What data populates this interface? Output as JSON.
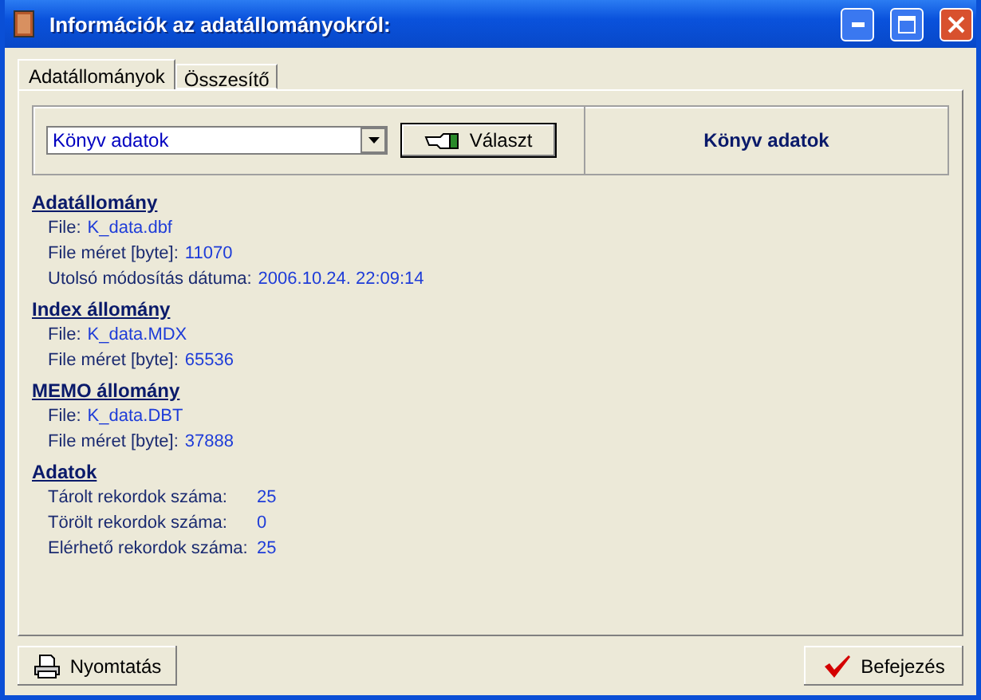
{
  "window": {
    "title": "Információk az adatállományokról:"
  },
  "tabs": [
    {
      "label": "Adatállományok",
      "selected": true
    },
    {
      "label": "Összesítő",
      "selected": false
    }
  ],
  "selector": {
    "value": "Könyv adatok",
    "button": "Választ",
    "caption": "Könyv adatok"
  },
  "sections": [
    {
      "title": "Adatállomány",
      "kind": "inline",
      "rows": [
        {
          "label": "File:",
          "value": "K_data.dbf"
        },
        {
          "label": "File méret [byte]:",
          "value": "11070"
        },
        {
          "label": "Utolsó módosítás dátuma:",
          "value": "2006.10.24. 22:09:14"
        }
      ]
    },
    {
      "title": "Index állomány",
      "kind": "inline",
      "rows": [
        {
          "label": "File:",
          "value": "K_data.MDX"
        },
        {
          "label": "File méret [byte]:",
          "value": "65536"
        }
      ]
    },
    {
      "title": "MEMO állomány",
      "kind": "inline",
      "rows": [
        {
          "label": "File:",
          "value": "K_data.DBT"
        },
        {
          "label": "File méret [byte]:",
          "value": "37888"
        }
      ]
    },
    {
      "title": "Adatok",
      "kind": "columns",
      "rows": [
        {
          "label": "Tárolt rekordok száma:",
          "value": "25"
        },
        {
          "label": "Törölt rekordok száma:",
          "value": "0"
        },
        {
          "label": "Elérhető rekordok száma:",
          "value": "25"
        }
      ]
    }
  ],
  "buttons": [
    {
      "kind": "print",
      "label": "Nyomtatás"
    },
    {
      "kind": "finish",
      "label": "Befejezés"
    }
  ]
}
